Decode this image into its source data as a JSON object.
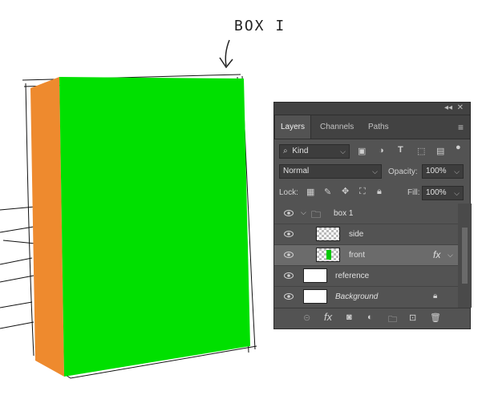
{
  "annotation": "BOX I",
  "colors": {
    "front_face": "#00e000",
    "side_face": "#ee8a2e",
    "panel_bg": "#535353"
  },
  "panel": {
    "tabs": [
      "Layers",
      "Channels",
      "Paths"
    ],
    "active_tab": "Layers",
    "filter": {
      "value": "Kind",
      "icon": "search-icon"
    },
    "blend_mode": "Normal",
    "opacity_label": "Opacity:",
    "opacity_value": "100%",
    "lock_label": "Lock:",
    "fill_label": "Fill:",
    "fill_value": "100%",
    "layers": [
      {
        "name": "box 1",
        "type": "group",
        "selected": false
      },
      {
        "name": "side",
        "type": "smart-object",
        "selected": false
      },
      {
        "name": "front",
        "type": "smart-object",
        "selected": true,
        "fx": "fx"
      },
      {
        "name": "reference",
        "type": "image",
        "selected": false
      },
      {
        "name": "Background",
        "type": "background",
        "locked": true,
        "selected": false
      }
    ]
  }
}
